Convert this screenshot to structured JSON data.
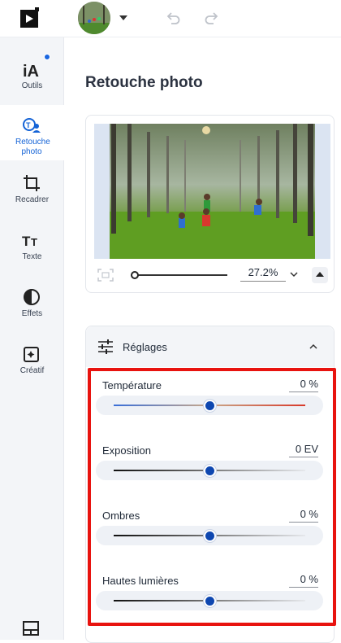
{
  "sidebar": {
    "items": [
      {
        "label": "Outils",
        "icon": "ai-icon"
      },
      {
        "label": "Retouche photo",
        "icon": "photo-retouch-icon"
      },
      {
        "label": "Recadrer",
        "icon": "crop-icon"
      },
      {
        "label": "Texte",
        "icon": "text-icon"
      },
      {
        "label": "Effets",
        "icon": "effects-icon"
      },
      {
        "label": "Créatif",
        "icon": "creative-icon"
      }
    ],
    "active_index": 1,
    "accent_color": "#1463d6"
  },
  "panel": {
    "title": "Retouche photo"
  },
  "zoom": {
    "value": "27.2%"
  },
  "adjustments": {
    "title": "Réglages",
    "sliders": [
      {
        "label": "Température",
        "value": "0 %",
        "level": 0.5
      },
      {
        "label": "Exposition",
        "value": "0 EV",
        "level": 0.5
      },
      {
        "label": "Ombres",
        "value": "0 %",
        "level": 0.5
      },
      {
        "label": "Hautes lumières",
        "value": "0 %",
        "level": 0.5
      }
    ]
  },
  "colors": {
    "highlight_border": "#e8130f",
    "slider_knob": "#0e47b0"
  }
}
